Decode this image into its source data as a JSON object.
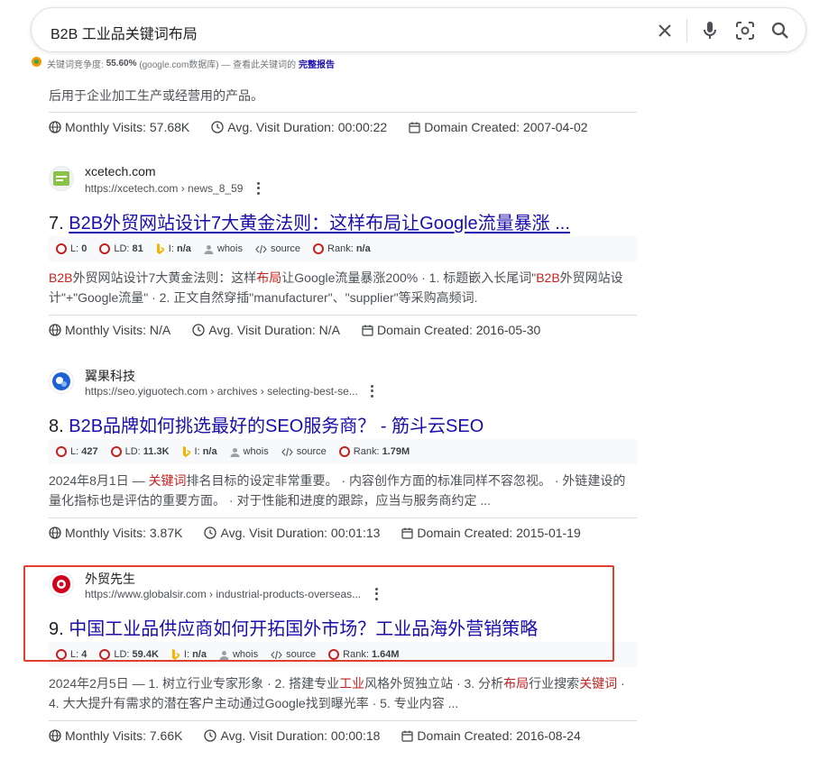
{
  "search": {
    "query": "B2B 工业品关键词布局"
  },
  "keyword_bar": {
    "label": "关键词竞争度:",
    "value": "55.60%",
    "source": "(google.com数据库) — 查看此关键词的",
    "link": "完整报告"
  },
  "top_snippet": "后用于企业加工生产或经营用的产品。",
  "top_stats": {
    "visits": "Monthly Visits: 57.68K",
    "duration": "Avg. Visit Duration: 00:00:22",
    "created": "Domain Created: 2007-04-02"
  },
  "results": [
    {
      "site": "xcetech.com",
      "url": "https://xcetech.com › news_8_59",
      "number": "7.",
      "title": "B2B外贸网站设计7大黄金法则：这样布局让Google流量暴涨 ...",
      "seo": {
        "L": "0",
        "LD": "81",
        "I": "n/a",
        "whois": "whois",
        "source": "source",
        "rank": "n/a"
      },
      "desc_parts": [
        {
          "t": "B2B",
          "h": true
        },
        {
          "t": "外贸网站设计7大黄金法则：这样",
          "h": false
        },
        {
          "t": "布局",
          "h": true
        },
        {
          "t": "让Google流量暴涨200% · 1. 标题嵌入长尾词\"",
          "h": false
        },
        {
          "t": "B2B",
          "h": true
        },
        {
          "t": "外贸网站设计\"+\"Google流量\" · 2. 正文自然穿插\"manufacturer\"、\"supplier\"等采购高频词.",
          "h": false
        }
      ],
      "stats": {
        "visits": "Monthly Visits: N/A",
        "duration": "Avg. Visit Duration: N/A",
        "created": "Domain Created: 2016-05-30"
      }
    },
    {
      "site": "翼果科技",
      "url": "https://seo.yiguotech.com › archives › selecting-best-se...",
      "number": "8.",
      "title": "B2B品牌如何挑选最好的SEO服务商？ - 筋斗云SEO",
      "seo": {
        "L": "427",
        "LD": "11.3K",
        "I": "n/a",
        "whois": "whois",
        "source": "source",
        "rank": "1.79M"
      },
      "desc_parts": [
        {
          "t": "2024年8月1日 — ",
          "h": false
        },
        {
          "t": "关键词",
          "h": true
        },
        {
          "t": "排名目标的设定非常重要。 · 内容创作方面的标准同样不容忽视。 · 外链建设的量化指标也是评估的重要方面。 · 对于性能和进度的跟踪，应当与服务商约定 ...",
          "h": false
        }
      ],
      "stats": {
        "visits": "Monthly Visits: 3.87K",
        "duration": "Avg. Visit Duration: 00:01:13",
        "created": "Domain Created: 2015-01-19"
      }
    },
    {
      "site": "外贸先生",
      "url": "https://www.globalsir.com › industrial-products-overseas...",
      "number": "9.",
      "title": "中国工业品供应商如何开拓国外市场？工业品海外营销策略",
      "seo": {
        "L": "4",
        "LD": "59.4K",
        "I": "n/a",
        "whois": "whois",
        "source": "source",
        "rank": "1.64M"
      },
      "desc_parts": [
        {
          "t": "2024年2月5日 — 1. 树立行业专家形象 · 2. 搭建专业",
          "h": false
        },
        {
          "t": "工业",
          "h": true
        },
        {
          "t": "风格外贸独立站 · 3. 分析",
          "h": false
        },
        {
          "t": "布局",
          "h": true
        },
        {
          "t": "行业搜索",
          "h": false
        },
        {
          "t": "关键词",
          "h": true
        },
        {
          "t": " · 4. 大大提升有需求的潜在客户主动通过Google找到曝光率 · 5. 专业内容 ...",
          "h": false
        }
      ],
      "stats": {
        "visits": "Monthly Visits: 7.66K",
        "duration": "Avg. Visit Duration: 00:00:18",
        "created": "Domain Created: 2016-08-24"
      }
    }
  ],
  "colors": {
    "link": "#1a0dab",
    "highlight": "#c5221f",
    "red_box": "#e0402e"
  }
}
